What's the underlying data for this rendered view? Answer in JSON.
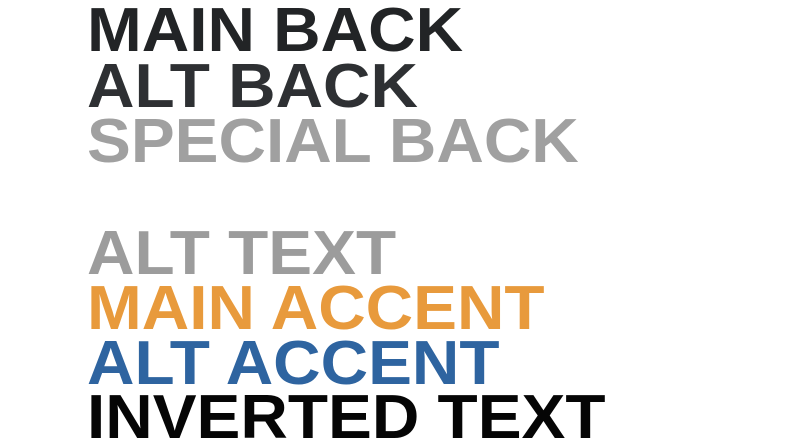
{
  "colors": {
    "main_back": "#222426",
    "alt_back": "#2e3033",
    "special_back": "#a0a0a0",
    "alt_text": "#9c9c9c",
    "main_accent": "#e89a3c",
    "alt_accent": "#2e64a0",
    "inverted_text": "#050505"
  },
  "swatches": {
    "main_back": "MAIN BACK",
    "alt_back": "ALT BACK",
    "special_back": "SPECIAL BACK",
    "alt_text": "ALT TEXT",
    "main_accent": "MAIN ACCENT",
    "alt_accent": "ALT ACCENT",
    "inverted_text": "INVERTED TEXT"
  }
}
